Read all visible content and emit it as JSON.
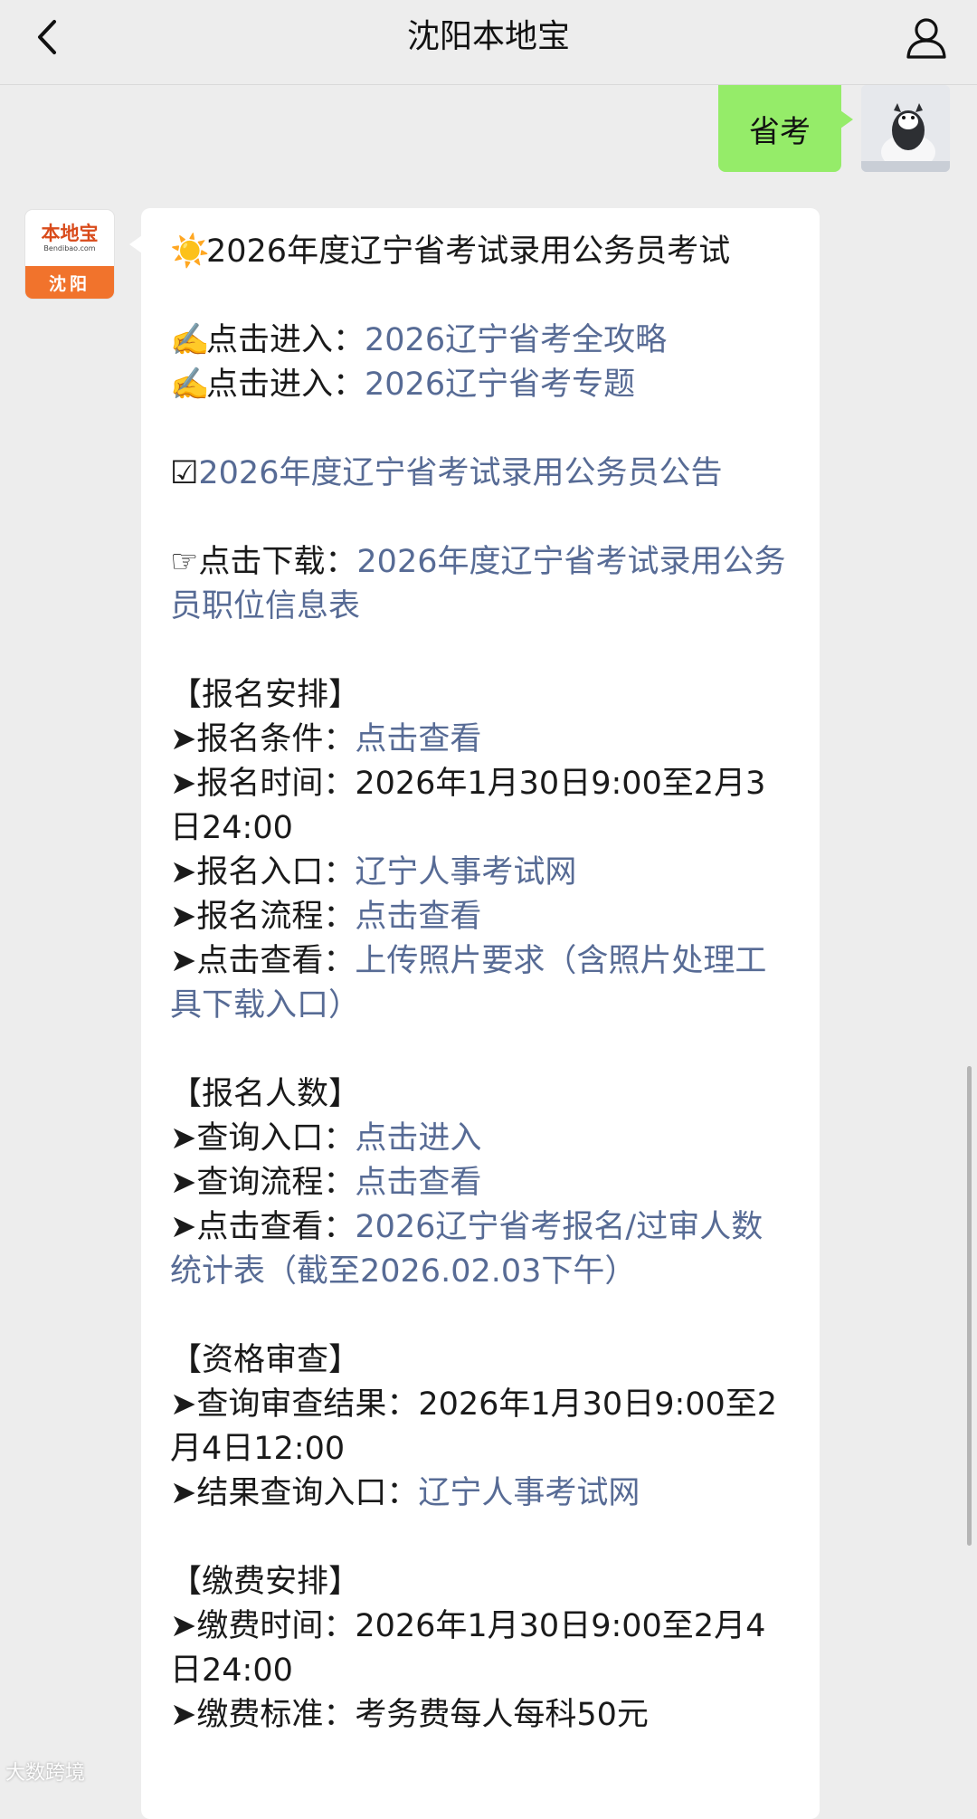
{
  "header": {
    "title": "沈阳本地宝",
    "back_icon": "chevron-left-icon",
    "profile_icon": "person-icon"
  },
  "outgoing": {
    "text": "省考",
    "bubble_color": "#95ec69"
  },
  "bot": {
    "logo_name": "本地宝",
    "logo_sub": "Bendibao.com",
    "logo_city": "沈阳"
  },
  "message": {
    "title_emoji": "☀️",
    "title": "2026年度辽宁省考试录用公务员考试",
    "entries": [
      {
        "emoji": "✍️",
        "label": "点击进入：",
        "link": "2026辽宁省考全攻略"
      },
      {
        "emoji": "✍️",
        "label": "点击进入：",
        "link": "2026辽宁省考专题"
      }
    ],
    "notice_check": "☑",
    "notice_link": "2026年度辽宁省考试录用公务员公告",
    "download_hand": "☞",
    "download_label": "点击下载：",
    "download_link": "2026年度辽宁省考试录用公务员职位信息表",
    "sections": {
      "registration": {
        "heading": "【报名安排】",
        "conditions_label": "➤报名条件：",
        "conditions_link": "点击查看",
        "time_label": "➤报名时间：",
        "time_value": "2026年1月30日9:00至2月3日24:00",
        "entry_label": "➤报名入口：",
        "entry_link": "辽宁人事考试网",
        "process_label": "➤报名流程：",
        "process_link": "点击查看",
        "photo_label": "➤点击查看：",
        "photo_link": "上传照片要求（含照片处理工具下载入口）"
      },
      "applicants": {
        "heading": "【报名人数】",
        "query_label": "➤查询入口：",
        "query_link": "点击进入",
        "process_label": "➤查询流程：",
        "process_link": "点击查看",
        "stats_label": "➤点击查看：",
        "stats_link": "2026辽宁省考报名/过审人数统计表（截至2026.02.03下午）"
      },
      "review": {
        "heading": "【资格审查】",
        "result_label": "➤查询审查结果：",
        "result_value": "2026年1月30日9:00至2月4日12:00",
        "entry_label": "➤结果查询入口：",
        "entry_link": "辽宁人事考试网"
      },
      "payment": {
        "heading": "【缴费安排】",
        "time_label": "➤缴费时间：",
        "time_value": "2026年1月30日9:00至2月4日24:00",
        "fee_label": "➤缴费标准：",
        "fee_value": "考务费每人每科50元"
      }
    }
  },
  "watermark": "大数跨境",
  "link_color": "#576b95"
}
